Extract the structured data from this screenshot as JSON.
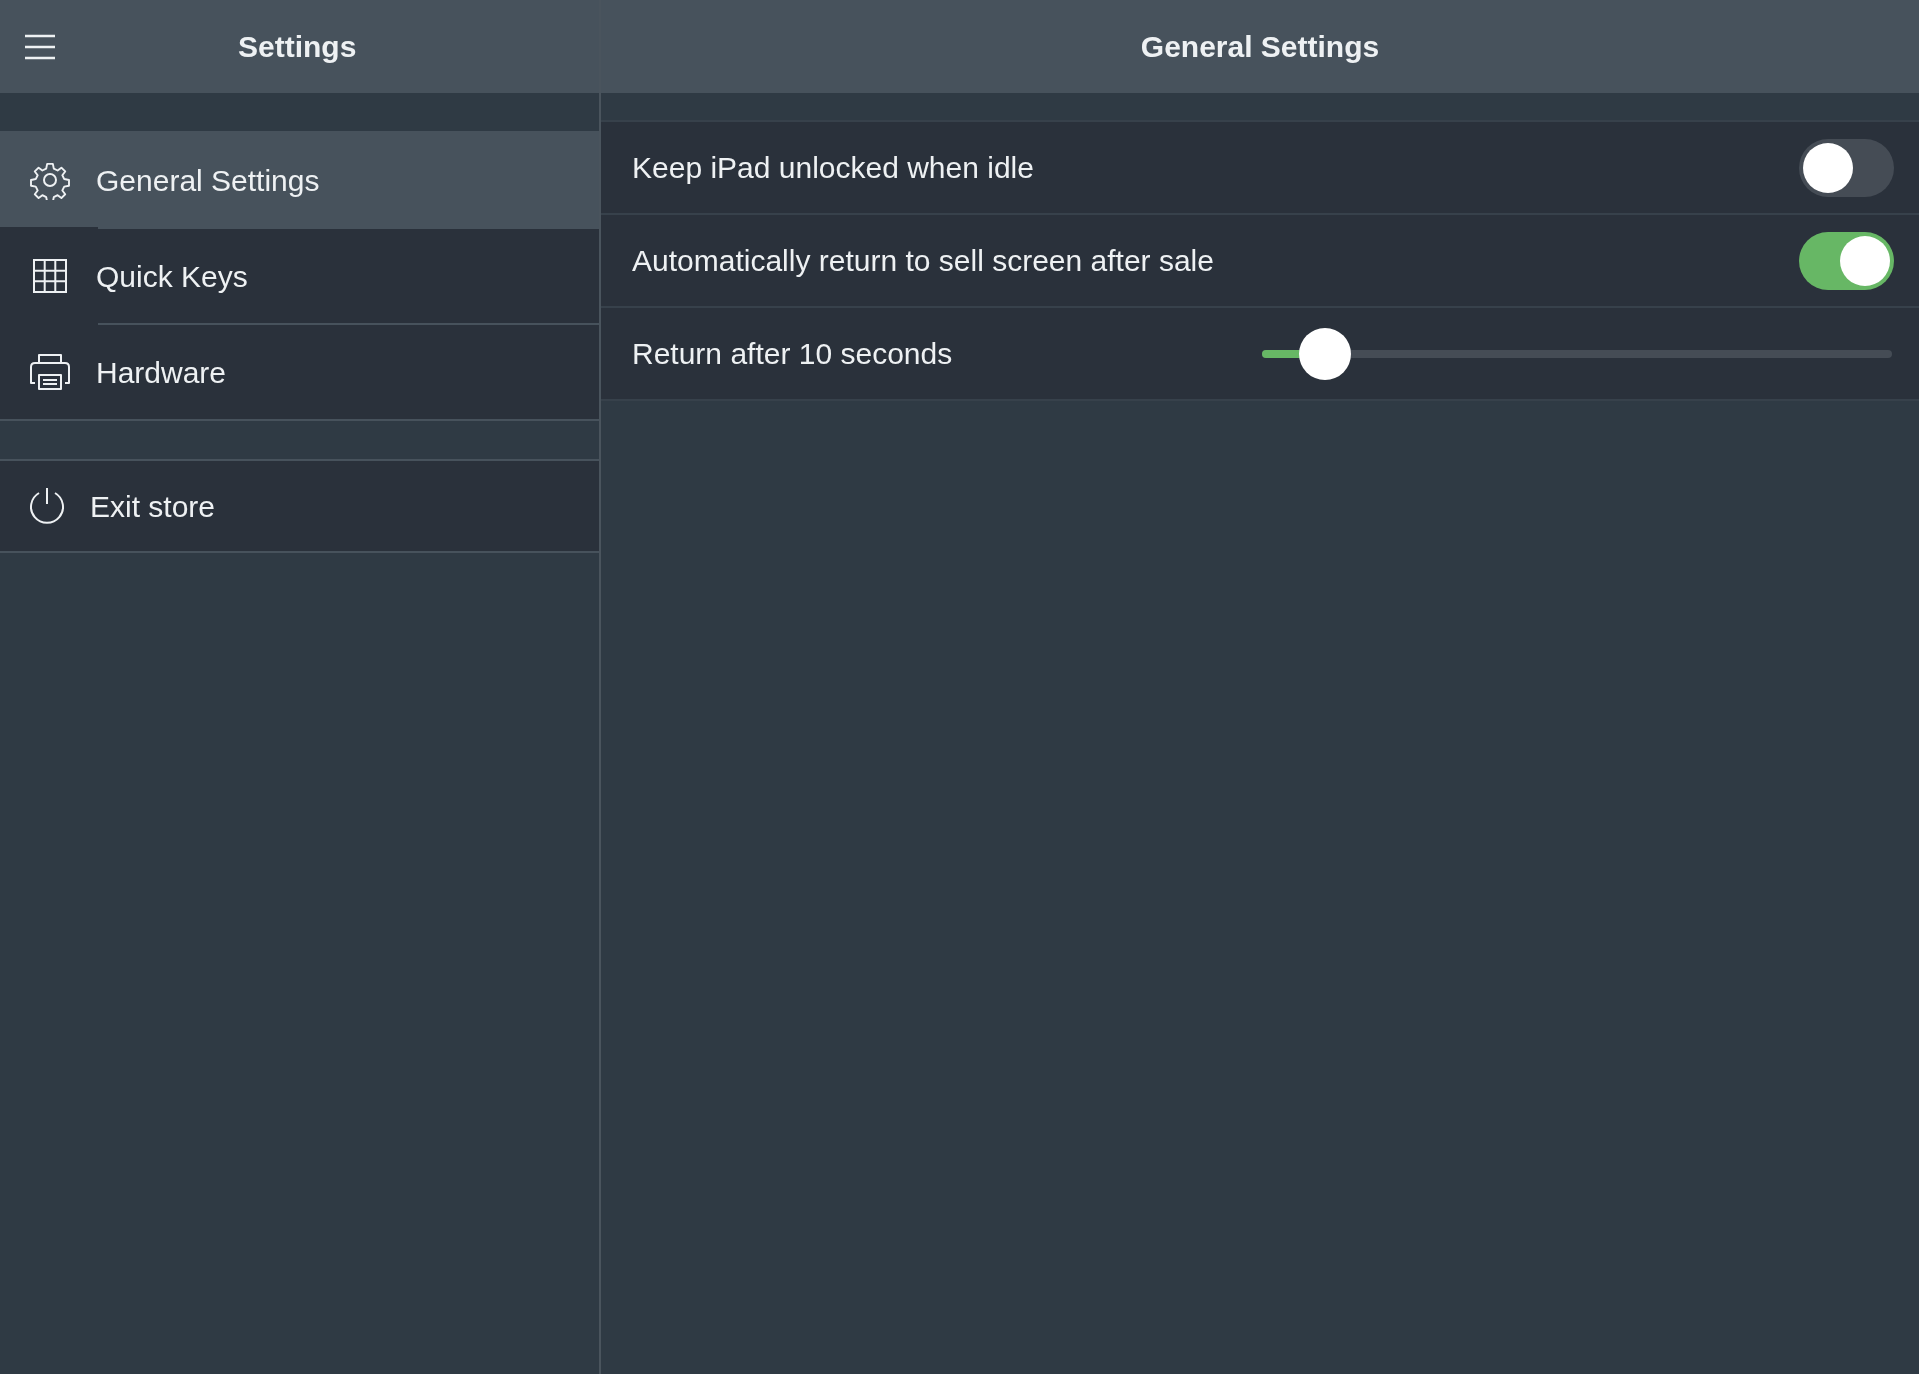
{
  "sidebar": {
    "title": "Settings",
    "items": [
      {
        "kind": "gear",
        "label": "General Settings",
        "selected": true
      },
      {
        "kind": "grid",
        "label": "Quick Keys",
        "selected": false
      },
      {
        "kind": "printer",
        "label": "Hardware",
        "selected": false
      }
    ],
    "exit": {
      "label": "Exit store"
    }
  },
  "main": {
    "title": "General Settings",
    "rows": [
      {
        "kind": "toggle",
        "label": "Keep iPad unlocked when idle",
        "on": false
      },
      {
        "kind": "toggle",
        "label": "Automatically return to sell screen after sale",
        "on": true
      },
      {
        "kind": "slider",
        "label": "Return after 10 seconds",
        "level": 0.1
      }
    ]
  }
}
